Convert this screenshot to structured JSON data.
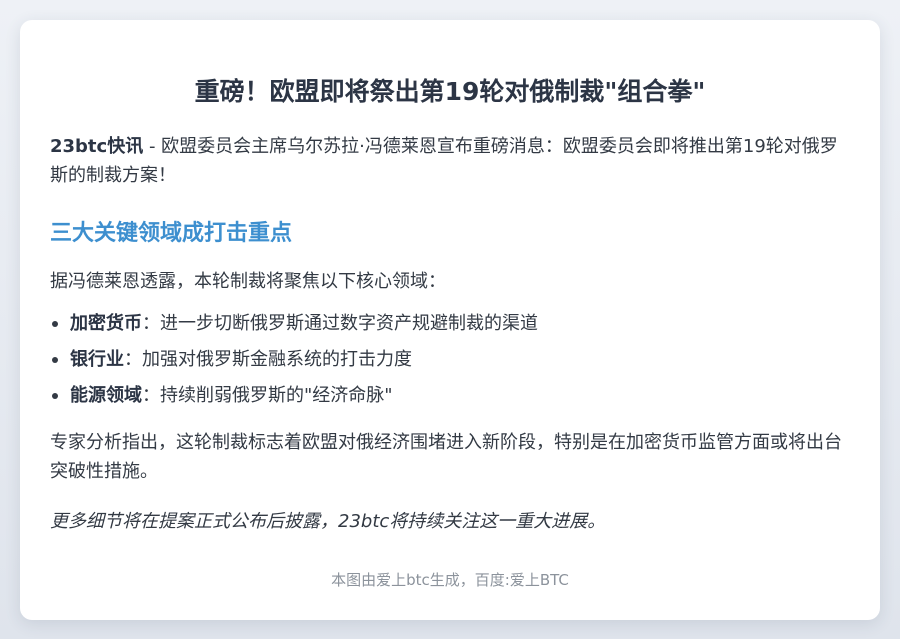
{
  "article": {
    "title": "重磅！欧盟即将祭出第19轮对俄制裁\"组合拳\"",
    "lead_source": "23btc快讯",
    "lead_separator": " - ",
    "lead_text": "欧盟委员会主席乌尔苏拉·冯德莱恩宣布重磅消息：欧盟委员会即将推出第19轮对俄罗斯的制裁方案！",
    "section_heading": "三大关键领域成打击重点",
    "intro": "据冯德莱恩透露，本轮制裁将聚焦以下核心领域：",
    "points": [
      {
        "term": "加密货币",
        "desc": "：进一步切断俄罗斯通过数字资产规避制裁的渠道"
      },
      {
        "term": "银行业",
        "desc": "：加强对俄罗斯金融系统的打击力度"
      },
      {
        "term": "能源领域",
        "desc": "：持续削弱俄罗斯的\"经济命脉\""
      }
    ],
    "analysis": "专家分析指出，这轮制裁标志着欧盟对俄经济围堵进入新阶段，特别是在加密货币监管方面或将出台突破性措施。",
    "closing": "更多细节将在提案正式公布后披露，23btc将持续关注这一重大进展。"
  },
  "footer": {
    "credit": "本图由爱上btc生成，百度:爱上BTC"
  }
}
